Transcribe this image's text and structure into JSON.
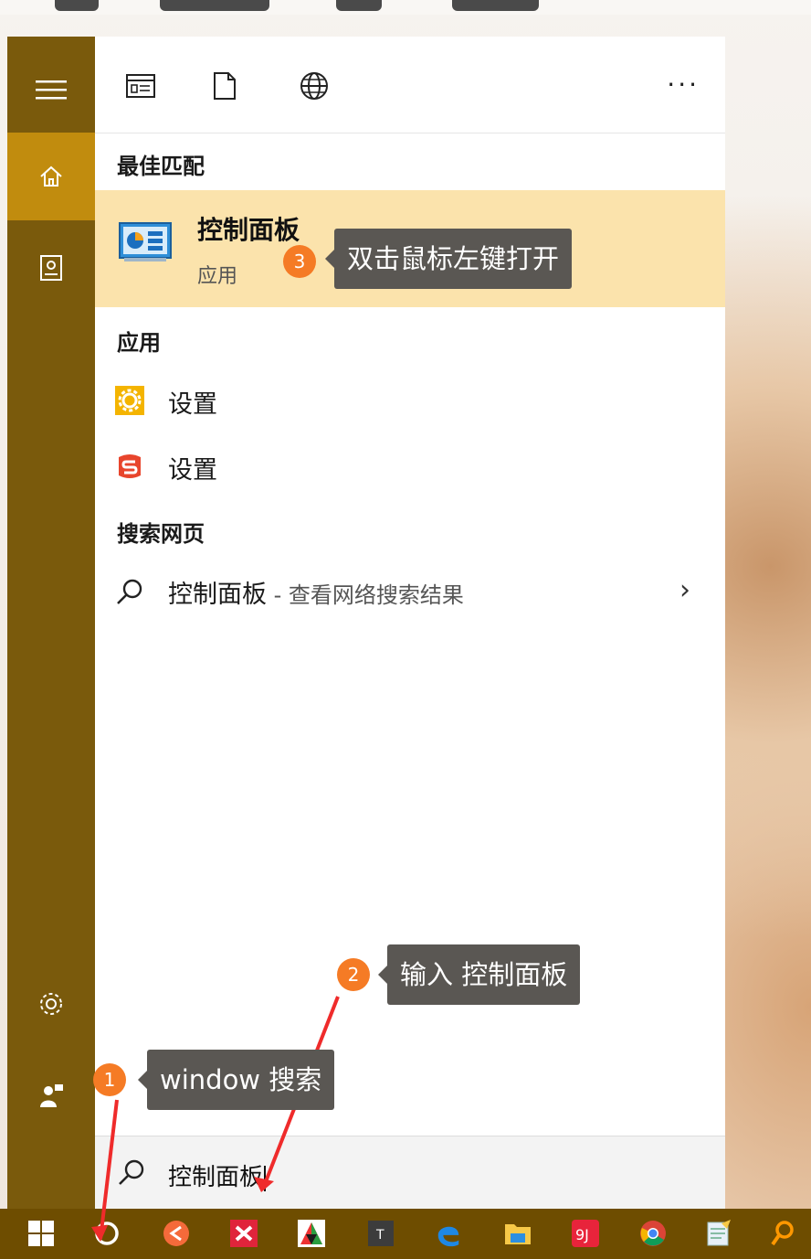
{
  "sidebar": {
    "items": [
      {
        "icon": "hamburger-menu-icon"
      },
      {
        "icon": "home-icon",
        "active": true
      },
      {
        "icon": "notebook-icon"
      },
      {
        "icon": "gear-icon"
      },
      {
        "icon": "feedback-icon"
      }
    ]
  },
  "topbar": {
    "tabs": [
      {
        "icon": "apps-filter-icon"
      },
      {
        "icon": "documents-filter-icon"
      },
      {
        "icon": "web-filter-icon"
      }
    ],
    "more_label": "..."
  },
  "best_match": {
    "section_title": "最佳匹配",
    "title": "控制面板",
    "subtitle": "应用",
    "icon": "control-panel-icon",
    "highlight_color": "#fbe3ac"
  },
  "apps": {
    "section_title": "应用",
    "items": [
      {
        "label": "设置",
        "icon": "settings-gear-yellow-icon"
      },
      {
        "label": "设置",
        "icon": "sogou-s-icon"
      }
    ]
  },
  "web": {
    "section_title": "搜索网页",
    "query": "控制面板",
    "suffix": " - 查看网络搜索结果"
  },
  "search": {
    "value": "控制面板"
  },
  "annotations": [
    {
      "number": "1",
      "text": "window 搜索"
    },
    {
      "number": "2",
      "text": "输入 控制面板"
    },
    {
      "number": "3",
      "text": "双击鼠标左键打开"
    }
  ],
  "colors": {
    "accent_dark": "#7a5a0c",
    "accent_active": "#c18c0e",
    "taskbar": "#6e4d00",
    "badge": "#f57b25",
    "tooltip": "#5a5753",
    "arrow": "#ef2b2b"
  }
}
